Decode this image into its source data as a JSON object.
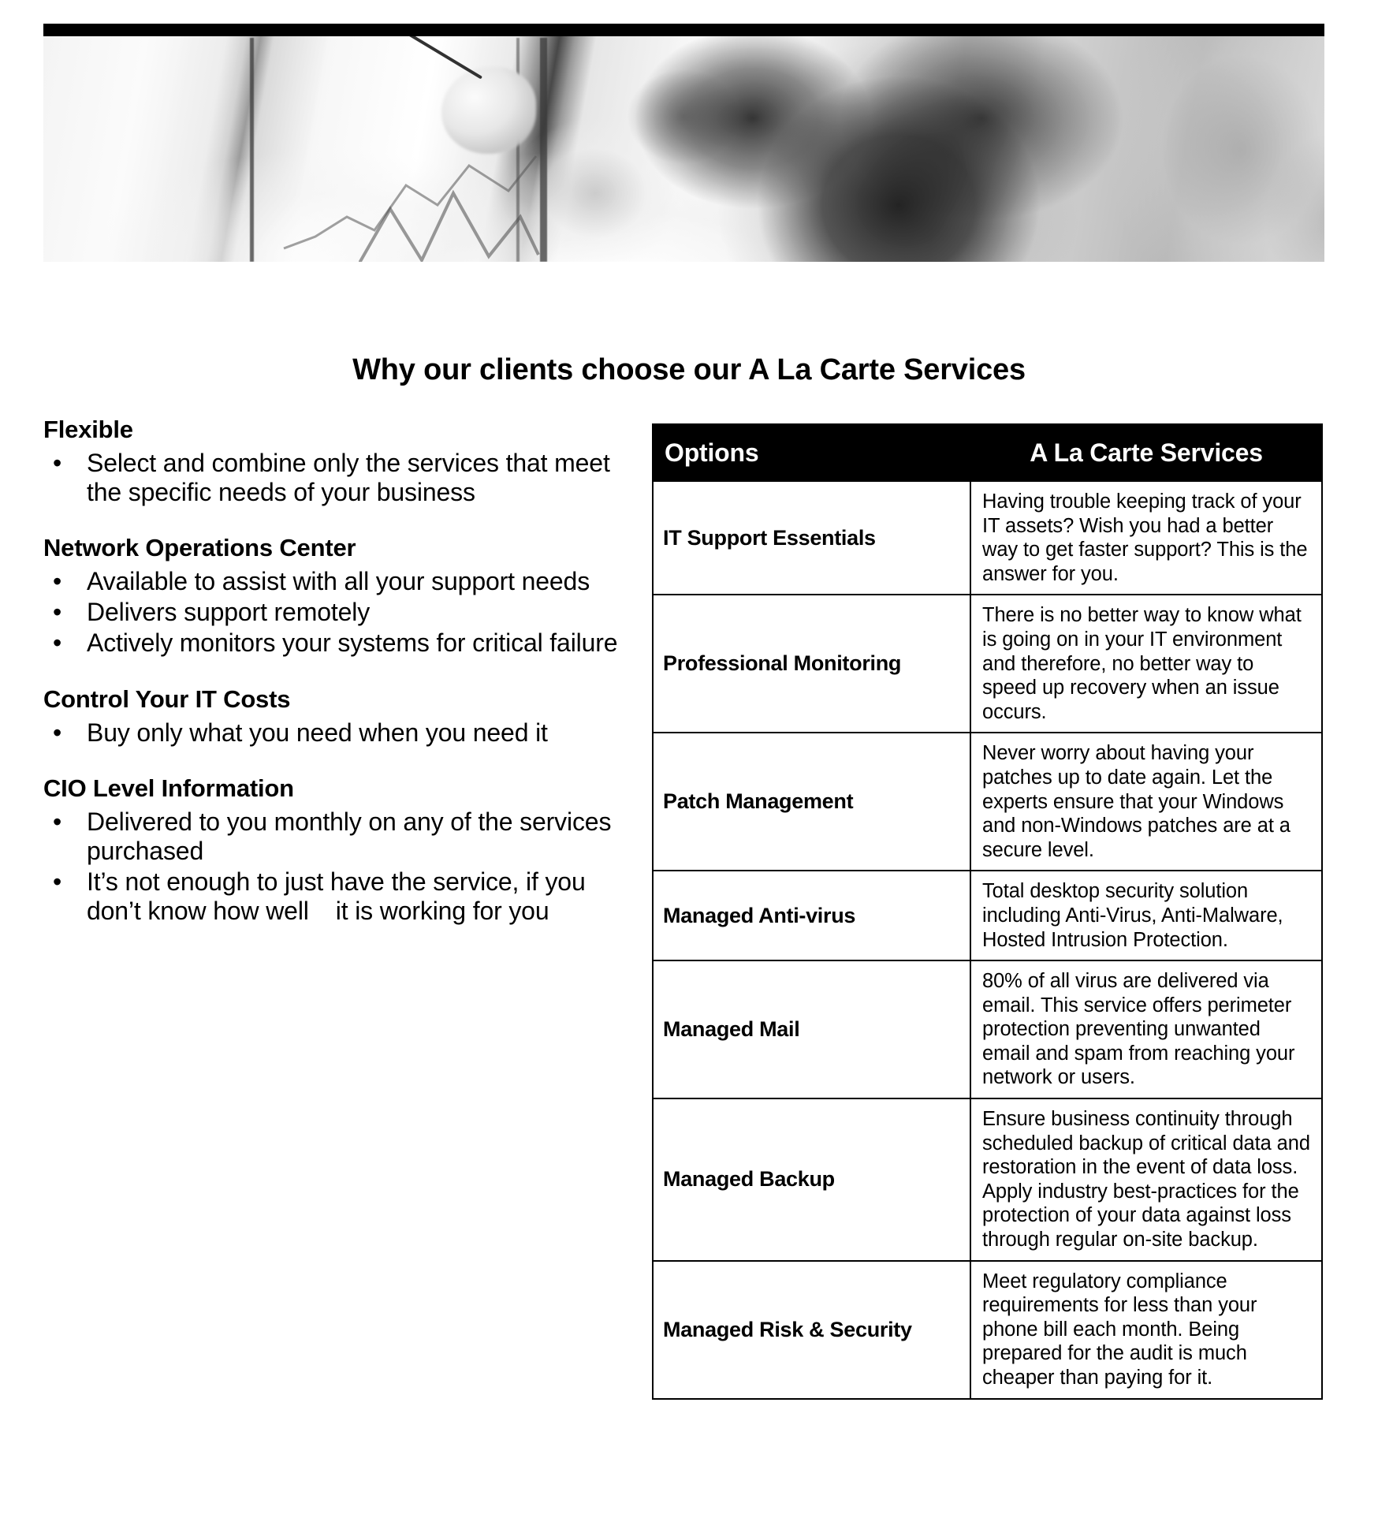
{
  "header_image": {
    "alt": "Two business people reviewing charts on a flipchart, grayscale photo",
    "icon": "business-meeting-photo"
  },
  "title": "Why our clients choose our A La Carte Services",
  "left_column": {
    "sections": [
      {
        "heading": "Flexible",
        "bullets": [
          "Select and combine only the services that meet the specific needs of your business"
        ]
      },
      {
        "heading": "Network Operations Center",
        "bullets": [
          "Available to assist with all your support needs",
          "Delivers support remotely",
          "Actively monitors your systems for critical failure"
        ]
      },
      {
        "heading": "Control Your IT Costs",
        "bullets": [
          "Buy only what you need when you need it"
        ]
      },
      {
        "heading": "CIO Level Information",
        "bullets": [
          "Delivered to you monthly on any of the services purchased"
        ],
        "bullets_split": [
          {
            "before": "It’s not enough to just have the service, if you don’t know how well",
            "after": "it is working for you"
          }
        ]
      }
    ]
  },
  "table": {
    "columns": [
      "Options",
      "A La Carte Services"
    ],
    "rows": [
      {
        "option": "IT Support Essentials",
        "description": "Having trouble keeping track of your IT assets? Wish you had a better way to get faster support? This is the answer for you."
      },
      {
        "option": "Professional Monitoring",
        "description": "There is no better way to know what is going on in your IT environment and therefore, no better way to speed up recovery when an issue occurs."
      },
      {
        "option": "Patch Management",
        "description": "Never worry about having your patches up to date again. Let the experts ensure that your Windows and non-Windows patches are at a secure level."
      },
      {
        "option": "Managed Anti-virus",
        "description": "Total desktop security solution including Anti-Virus, Anti-Malware, Hosted Intrusion Protection."
      },
      {
        "option": "Managed Mail",
        "description": "80% of all virus are delivered via email. This service offers perimeter protection preventing unwanted email and spam from reaching your network or users."
      },
      {
        "option": "Managed Backup",
        "description": "Ensure business continuity through scheduled backup of critical data and restoration in the event of data loss. Apply industry best-practices for the protection of your data against loss through regular on-site backup."
      },
      {
        "option": "Managed Risk & Security",
        "description": "Meet regulatory compliance requirements for less than your phone bill each month. Being prepared for the audit is much cheaper than paying for it."
      }
    ]
  },
  "colors": {
    "text": "#000000",
    "table_header_bg": "#000000",
    "table_header_text": "#ffffff",
    "page_bg": "#ffffff",
    "border": "#000000"
  }
}
